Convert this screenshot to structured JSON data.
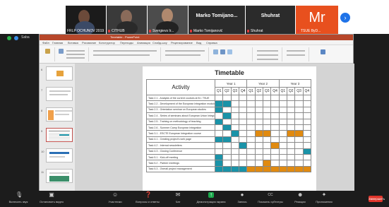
{
  "gallery": {
    "tiles": [
      {
        "name": "FRLP OCHUNOV 2019"
      },
      {
        "name": "CITHUB"
      },
      {
        "name": "Svergievs Ir..."
      },
      {
        "name": "Marko Tomijanović"
      },
      {
        "name": "Shuhrat"
      },
      {
        "name": "TSUE ByD...",
        "initials": "Mr"
      }
    ],
    "name_only_tile": "Marko Tomijano...",
    "name_only_tile_2": "Shuhrat"
  },
  "zoom": {
    "left_label": "Saba"
  },
  "ppt": {
    "window_title": "Timetable - PowerPoint",
    "tabs": [
      "Файл",
      "Главная",
      "Вставка",
      "Рисование",
      "Конструктор",
      "Переходы",
      "Анимация",
      "Слайд-шоу",
      "Рецензирование",
      "Вид",
      "Справка"
    ],
    "thumb_numbers": [
      "6",
      "7",
      "8",
      "9",
      "10",
      "11"
    ]
  },
  "slide": {
    "title": "Timetable",
    "activity_header": "Activity",
    "years": [
      "Year 1",
      "Year 2",
      "Year 3"
    ],
    "quarters": [
      "Q1",
      "Q2",
      "Q3",
      "Q4",
      "Q1",
      "Q2",
      "Q3",
      "Q4",
      "Q1",
      "Q2",
      "Q3",
      "Q4"
    ],
    "tasks": [
      {
        "label": "Task 2.1 - Analysis of the current courses at B.I. TSUE",
        "cells": [
          "",
          "",
          "",
          "",
          "",
          "",
          "",
          "",
          "",
          "",
          "",
          ""
        ]
      },
      {
        "label": "Task 2.2 - Development of the European Integration module",
        "cells": [
          "teal",
          "teal",
          "",
          "",
          "",
          "",
          "",
          "",
          "",
          "",
          "",
          ""
        ]
      },
      {
        "label": "Task 2.3 - Orientation seminar on European studies",
        "cells": [
          "teal",
          "",
          "",
          "",
          "",
          "",
          "",
          "",
          "",
          "",
          "",
          ""
        ]
      },
      {
        "label": "Task 2.4 - Series of seminars about European Union Integration",
        "cells": [
          "",
          "teal",
          "",
          "",
          "",
          "",
          "",
          "",
          "",
          "",
          "",
          ""
        ]
      },
      {
        "label": "Task 2.5 - Training on methodology of teaching",
        "cells": [
          "teal",
          "",
          "",
          "",
          "",
          "",
          "",
          "",
          "",
          "",
          "",
          ""
        ]
      },
      {
        "label": "Task 2.6 - Summer Camp European Integration",
        "cells": [
          "",
          "teal",
          "",
          "",
          "",
          "",
          "",
          "",
          "",
          "",
          "",
          ""
        ]
      },
      {
        "label": "Task 3.1 - ESCTE European Integration course",
        "cells": [
          "",
          "",
          "teal",
          "",
          "",
          "orange",
          "orange",
          "",
          "",
          "orange",
          "orange",
          ""
        ]
      },
      {
        "label": "Task 4.1 - Creating project's web page",
        "cells": [
          "teal",
          "teal",
          "",
          "",
          "",
          "",
          "",
          "",
          "",
          "",
          "",
          ""
        ]
      },
      {
        "label": "Task 4.2 - Internal newsletters",
        "cells": [
          "",
          "",
          "",
          "teal",
          "",
          "",
          "",
          "orange",
          "",
          "",
          "",
          ""
        ]
      },
      {
        "label": "Task 4.3 - Closing Conference",
        "cells": [
          "",
          "",
          "",
          "",
          "",
          "",
          "",
          "",
          "",
          "",
          "",
          "teal"
        ]
      },
      {
        "label": "Task 5.1 - Kick-off meeting",
        "cells": [
          "teal",
          "",
          "",
          "",
          "",
          "",
          "",
          "",
          "",
          "",
          "",
          ""
        ]
      },
      {
        "label": "Task 5.2 - Partner meetings",
        "cells": [
          "teal",
          "",
          "",
          "",
          "",
          "",
          "orange",
          "",
          "",
          "",
          "",
          ""
        ]
      },
      {
        "label": "Task 5.3 - Overall project management",
        "cells": [
          "teal",
          "teal",
          "teal",
          "teal",
          "orange",
          "orange",
          "orange",
          "orange",
          "orange",
          "orange",
          "orange",
          "orange"
        ]
      }
    ]
  },
  "toolbar": {
    "buttons": [
      {
        "label": "Включить звук",
        "icon": "🎙"
      },
      {
        "label": "Остановить видео",
        "icon": "▣"
      },
      {
        "label": "Участники",
        "icon": "☺"
      },
      {
        "label": "Вопросы и ответы",
        "icon": "❓"
      },
      {
        "label": "Чат",
        "icon": "✉"
      },
      {
        "label": "Демонстрация экрана",
        "icon": "↑"
      },
      {
        "label": "Запись",
        "icon": "●"
      },
      {
        "label": "Показать субтитры",
        "icon": "CC"
      },
      {
        "label": "Реакции",
        "icon": "☻"
      },
      {
        "label": "Приложения",
        "icon": "✦"
      }
    ],
    "end_label": "Завершить"
  },
  "colors": {
    "teal": "#1a93a8",
    "orange": "#e08a10",
    "ppt_accent": "#b7472a",
    "zoom_bg": "#1c1c1c"
  }
}
